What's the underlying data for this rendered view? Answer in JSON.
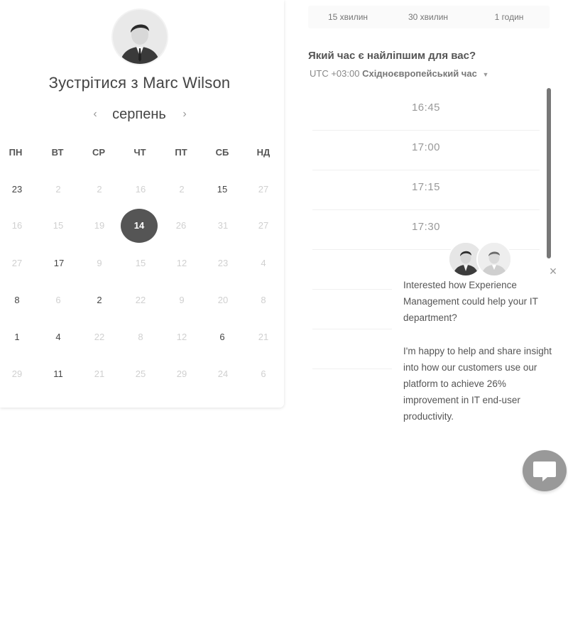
{
  "card": {
    "host_avatar_icon": "person-avatar",
    "title": "Зустрітися з Marc Wilson",
    "month": "серпень",
    "prev_icon": "‹",
    "next_icon": "›",
    "weekdays": [
      "ПН",
      "ВТ",
      "СР",
      "ЧТ",
      "ПТ",
      "СБ",
      "НД"
    ],
    "weeks": [
      [
        "23",
        "2",
        "2",
        "16",
        "2",
        "15",
        "27"
      ],
      [
        "16",
        "15",
        "19",
        "14",
        "26",
        "31",
        "27"
      ],
      [
        "27",
        "17",
        "9",
        "15",
        "12",
        "23",
        "4"
      ],
      [
        "8",
        "6",
        "2",
        "22",
        "9",
        "20",
        "8"
      ],
      [
        "1",
        "4",
        "22",
        "8",
        "12",
        "6",
        "21"
      ],
      [
        "29",
        "11",
        "21",
        "25",
        "29",
        "24",
        "6"
      ]
    ],
    "selected_day": "14"
  },
  "durations": [
    "15 хвилин",
    "30 хвилин",
    "1 годин"
  ],
  "question": "Який час є найліпшим для вас?",
  "timezone": {
    "offset": "UTC +03:00",
    "name": "Східноєвропейський час"
  },
  "times": [
    "16:45",
    "17:00",
    "17:15",
    "17:30",
    "",
    "",
    ""
  ],
  "chat": {
    "close_icon": "×",
    "message_1": "Interested how Experience Management could help your IT department?",
    "message_2": "I'm happy to help and share insight into how our customers use our platform to achieve 26% improvement in IT end-user productivity.",
    "button_icon": "chat-bubble-icon"
  },
  "colors": {
    "selected_day_bg": "#555555",
    "chat_button_bg": "#999999",
    "scrollbar": "#777777"
  }
}
